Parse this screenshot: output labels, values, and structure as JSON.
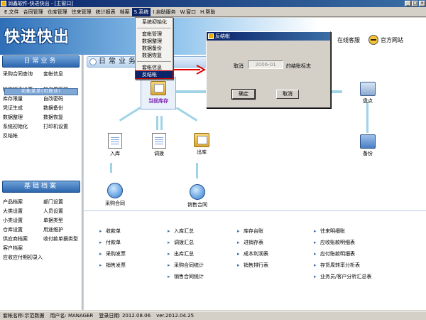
{
  "window": {
    "title": "润鑫软件-快进快出 - [主窗口]",
    "buttons": [
      "_",
      "□",
      "×"
    ]
  },
  "menubar": {
    "items": [
      "E.文件",
      "合同管理",
      "仓库管理",
      "往来管理",
      "统计报表",
      "档案",
      "S.系统",
      "I.自助服务",
      "W.窗口",
      "H.帮助"
    ],
    "active_index": 6
  },
  "system_menu": {
    "items": [
      "系统初始化",
      "套帐管理",
      "数据整理",
      "数据备份",
      "数据恢复",
      "套帐信息",
      "反结帐"
    ],
    "highlighted": "反结帐"
  },
  "banner": {
    "logo": "快进快出",
    "links": [
      "在线客服",
      "官方网站"
    ]
  },
  "left_panel": {
    "daily_header": "日常业务",
    "daily_items": [
      "采购合同查询",
      "套帐信息",
      "特殊报表设置",
      "操作员管理",
      "库存限量",
      "自改密码",
      "凭证生成",
      "数据备份",
      "数据整理",
      "数据恢复",
      "系统初始化",
      "打印机设置",
      "反结帐"
    ],
    "floatbar": "功能菜单(可拖动)",
    "basic_header": "基础档案",
    "basic_items": [
      "产品档案",
      "部门设置",
      "大类设置",
      "人员设置",
      "小类设置",
      "单据类型",
      "仓库设置",
      "用途维护",
      "供应商档案",
      "收付款单据类型",
      "客户档案",
      "应收应付期初录入"
    ]
  },
  "workspace": {
    "header": "日常业务",
    "center_node": "当前库存",
    "nodes": [
      "入库",
      "调拨",
      "出库",
      "采购合同",
      "销售合同",
      "盘点",
      "备份"
    ]
  },
  "links": {
    "col1": [
      "收款单",
      "付款单",
      "采购发票",
      "销售发票"
    ],
    "col2": [
      "入库汇总",
      "调拨汇总",
      "出库汇总",
      "采购合同统计",
      "销售合同统计"
    ],
    "col3": [
      "库存台账",
      "进销存表",
      "成本利润表",
      "销售排行表"
    ],
    "col4": [
      "往来明细账",
      "应收账款明细表",
      "应付账款明细表",
      "存货周转率分析表",
      "业务员/客户分析汇总表"
    ]
  },
  "dialog": {
    "title": "反结帐",
    "cancel_prefix": "取消",
    "period_value": "2006-01",
    "suffix": "的结账标志",
    "ok": "确定",
    "cancel": "取消"
  },
  "statusbar": {
    "account": "套帐名称:示范数据",
    "user": "用户名: MANAGER",
    "login_date": "登录日期: 2012.08.06",
    "version": "ver.2012.04.25"
  }
}
